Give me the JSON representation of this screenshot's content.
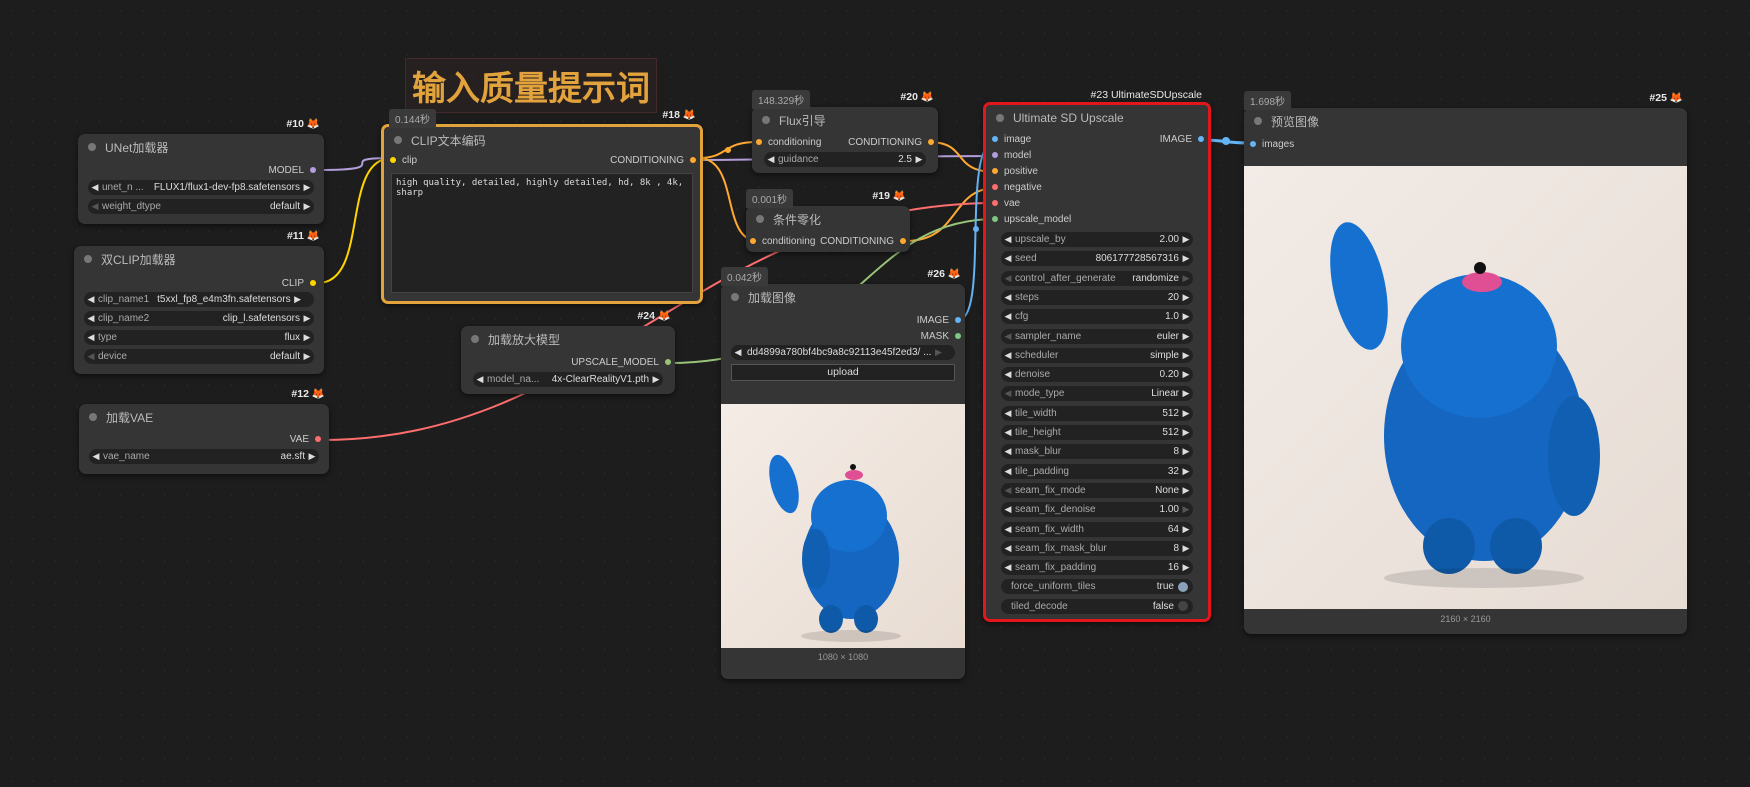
{
  "note": {
    "text": "输入质量提示词"
  },
  "nodes": {
    "unet": {
      "id": "#10",
      "title": "UNet加载器",
      "out_model": "MODEL",
      "w_unet_name": "unet_n ...",
      "w_unet_val": "FLUX1/flux1-dev-fp8.safetensors",
      "w_weight_name": "weight_dtype",
      "w_weight_val": "default"
    },
    "dualclip": {
      "id": "#11",
      "title": "双CLIP加载器",
      "out_clip": "CLIP",
      "w1_name": "clip_name1",
      "w1_val": "t5xxl_fp8_e4m3fn.safetensors",
      "w2_name": "clip_name2",
      "w2_val": "clip_l.safetensors",
      "w3_name": "type",
      "w3_val": "flux",
      "w4_name": "device",
      "w4_val": "default"
    },
    "vae": {
      "id": "#12",
      "title": "加载VAE",
      "out_vae": "VAE",
      "w_name": "vae_name",
      "w_val": "ae.sft"
    },
    "clipenc": {
      "id": "#18",
      "timing": "0.144秒",
      "title": "CLIP文本编码",
      "in_clip": "clip",
      "out_cond": "CONDITIONING",
      "prompt": "high quality, detailed, highly detailed, hd, 8k , 4k, sharp"
    },
    "fluxguide": {
      "id": "#20",
      "timing": "148.329秒",
      "title": "Flux引导",
      "in_cond": "conditioning",
      "out_cond": "CONDITIONING",
      "w_name": "guidance",
      "w_val": "2.5"
    },
    "zero": {
      "id": "#19",
      "timing": "0.001秒",
      "title": "条件零化",
      "in_cond": "conditioning",
      "out_cond": "CONDITIONING"
    },
    "upmodel": {
      "id": "#24",
      "title": "加载放大模型",
      "out": "UPSCALE_MODEL",
      "w_name": "model_na...",
      "w_val": "4x-ClearRealityV1.pth"
    },
    "loadimg": {
      "id": "#26",
      "timing": "0.042秒",
      "title": "加载图像",
      "out_image": "IMAGE",
      "out_mask": "MASK",
      "w_val": "dd4899a780bf4bc9a8c92113e45f2ed3/ ...",
      "upload": "upload",
      "caption": "1080 × 1080"
    },
    "usdu": {
      "id": "#23 UltimateSDUpscale",
      "title": "Ultimate SD Upscale",
      "inputs": [
        "image",
        "model",
        "positive",
        "negative",
        "vae",
        "upscale_model"
      ],
      "output": "IMAGE",
      "widgets": [
        {
          "name": "upscale_by",
          "value": "2.00"
        },
        {
          "name": "seed",
          "value": "806177728567316"
        },
        {
          "name": "control_after_generate",
          "value": "randomize"
        },
        {
          "name": "steps",
          "value": "20"
        },
        {
          "name": "cfg",
          "value": "1.0"
        },
        {
          "name": "sampler_name",
          "value": "euler"
        },
        {
          "name": "scheduler",
          "value": "simple"
        },
        {
          "name": "denoise",
          "value": "0.20"
        },
        {
          "name": "mode_type",
          "value": "Linear"
        },
        {
          "name": "tile_width",
          "value": "512"
        },
        {
          "name": "tile_height",
          "value": "512"
        },
        {
          "name": "mask_blur",
          "value": "8"
        },
        {
          "name": "tile_padding",
          "value": "32"
        },
        {
          "name": "seam_fix_mode",
          "value": "None"
        },
        {
          "name": "seam_fix_denoise",
          "value": "1.00"
        },
        {
          "name": "seam_fix_width",
          "value": "64"
        },
        {
          "name": "seam_fix_mask_blur",
          "value": "8"
        },
        {
          "name": "seam_fix_padding",
          "value": "16"
        }
      ],
      "toggles": [
        {
          "name": "force_uniform_tiles",
          "value": "true"
        },
        {
          "name": "tiled_decode",
          "value": "false"
        }
      ]
    },
    "preview": {
      "id": "#25",
      "timing": "1.698秒",
      "title": "预览图像",
      "in_images": "images",
      "caption": "2160 × 2160"
    }
  },
  "colors": {
    "model": "#b39ddb",
    "clip": "#ffd500",
    "conditioning": "#ffa931",
    "vae": "#ff6e6e",
    "image": "#64b5f6",
    "mask": "#81c784",
    "upscale_model": "#98c379",
    "accent_selected": "#e2171c",
    "accent_group": "#e2a23c"
  }
}
